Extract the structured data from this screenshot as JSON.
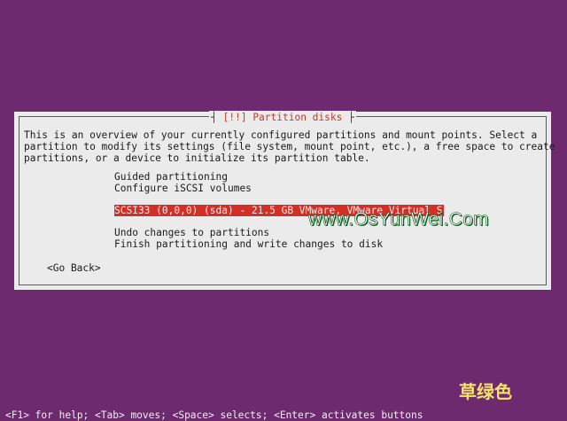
{
  "dialog": {
    "title": "[!!] Partition disks",
    "description": "This is an overview of your currently configured partitions and mount points. Select a\npartition to modify its settings (file system, mount point, etc.), a free space to create\npartitions, or a device to initialize its partition table.",
    "items": [
      {
        "label": "Guided partitioning"
      },
      {
        "label": "Configure iSCSI volumes"
      },
      {
        "label": ""
      },
      {
        "label": "SCSI33 (0,0,0) (sda) - 21.5 GB VMware, VMware Virtual S"
      },
      {
        "label": ""
      },
      {
        "label": "Undo changes to partitions"
      },
      {
        "label": "Finish partitioning and write changes to disk"
      }
    ],
    "go_back_label": "<Go Back>"
  },
  "help_bar": "<F1> for help; <Tab> moves; <Space> selects; <Enter> activates buttons",
  "watermark": {
    "text": "www.OsYunWei.Com",
    "cn_text": "草绿色"
  },
  "colors": {
    "background": "#6e2a6f",
    "dialog_bg": "#ebebeb",
    "selection": "#d22f27",
    "title": "#c23b2b"
  }
}
